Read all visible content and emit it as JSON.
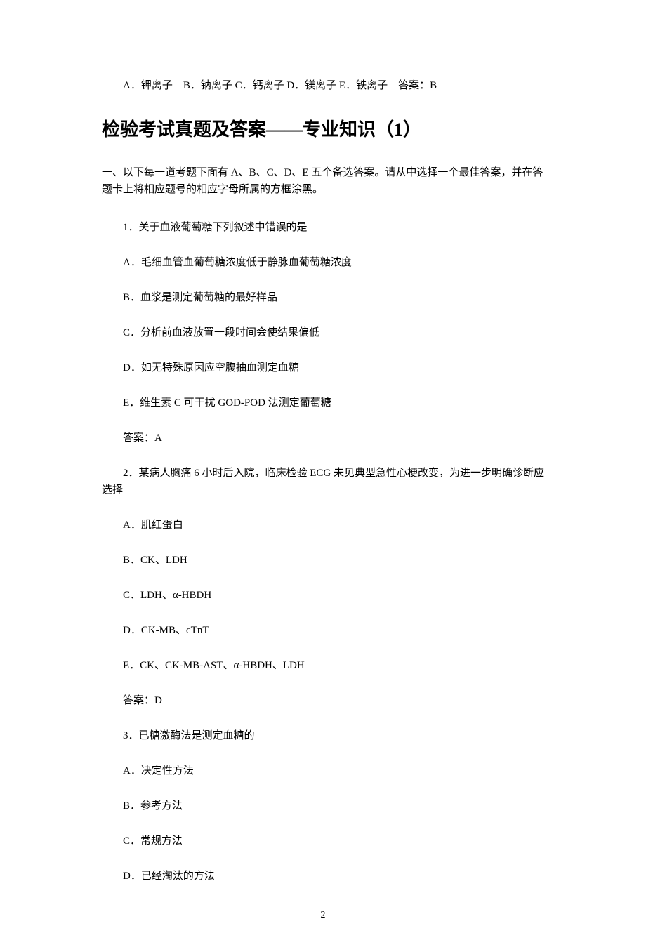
{
  "prevLine": "A．钾离子　B．钠离子 C．钙离子 D．镁离子 E．铁离子　答案：B",
  "title": "检验考试真题及答案——专业知识（1）",
  "intro": "一、以下每一道考题下面有 A、B、C、D、E 五个备选答案。请从中选择一个最佳答案，并在答题卡上将相应题号的相应字母所属的方框涂黑。",
  "q1": {
    "stem": "1．关于血液葡萄糖下列叙述中错误的是",
    "a": "A．毛细血管血葡萄糖浓度低于静脉血葡萄糖浓度",
    "b": "B．血浆是测定葡萄糖的最好样品",
    "c": "C．分析前血液放置一段时间会使结果偏低",
    "d": "D．如无特殊原因应空腹抽血测定血糖",
    "e": "E．维生素 C 可干扰 GOD-POD 法测定葡萄糖",
    "ans": "答案：A"
  },
  "q2": {
    "stemIndent": "　　2．某病人胸痛 6 小时后入院，临床检验 ECG 未见典型急性心梗改变，为进一步明确诊断应选择",
    "a": "A．肌红蛋白",
    "b": "B．CK、LDH",
    "c": "C．LDH、α-HBDH",
    "d": "D．CK-MB、cTnT",
    "e": "E．CK、CK-MB-AST、α-HBDH、LDH",
    "ans": "答案：D"
  },
  "q3": {
    "stem": "3．已糖激酶法是测定血糖的",
    "a": "A．决定性方法",
    "b": "B．参考方法",
    "c": "C．常规方法",
    "d": "D．已经淘汰的方法"
  },
  "pageNum": "2"
}
